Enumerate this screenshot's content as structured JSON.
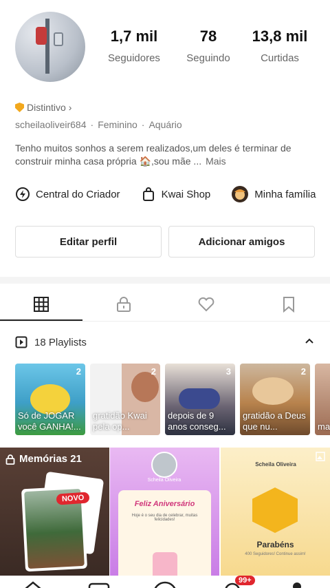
{
  "profile": {
    "avatar_icon": "iv-drip-avatar-photo",
    "stats": [
      {
        "value": "1,7 mil",
        "label": "Seguidores"
      },
      {
        "value": "78",
        "label": "Seguindo"
      },
      {
        "value": "13,8 mil",
        "label": "Curtidas"
      }
    ],
    "badge_label": "Distintivo",
    "badge_chevron": "›",
    "username": "scheilaoliveir684",
    "gender": "Feminino",
    "sign": "Aquário",
    "meta_separator": "·",
    "bio": "Tenho muitos sonhos a serem realizados,um deles é terminar de construir minha casa própria 🏠,sou mãe ...",
    "bio_more": "Mais"
  },
  "quick_links": [
    {
      "label": "Central do Criador",
      "icon": "bolt-circle-icon"
    },
    {
      "label": "Kwai Shop",
      "icon": "shopping-bag-icon"
    },
    {
      "label": "Minha família",
      "icon": "family-avatar-icon"
    }
  ],
  "buttons": {
    "edit_profile": "Editar perfil",
    "add_friends": "Adicionar amigos"
  },
  "tabs": [
    {
      "name": "grid",
      "icon": "grid-icon",
      "active": true
    },
    {
      "name": "private",
      "icon": "lock-icon",
      "active": false
    },
    {
      "name": "likes",
      "icon": "heart-icon",
      "active": false
    },
    {
      "name": "saved",
      "icon": "bookmark-icon",
      "active": false
    }
  ],
  "playlists": {
    "header": "18 Playlists",
    "items": [
      {
        "count": "2",
        "caption": "Só de JOGAR você GANHA!...",
        "color": "#4fb6d8"
      },
      {
        "count": "2",
        "caption": "gratidão Kwai pela op...",
        "color": "#e9d9d2"
      },
      {
        "count": "3",
        "caption": "depois de 9 anos conseg...",
        "color": "#3b3f56"
      },
      {
        "count": "2",
        "caption": "gratidão a Deus que nu...",
        "color": "#a86f45"
      },
      {
        "count": "",
        "caption": "ma de",
        "color": "#c9a28a"
      }
    ]
  },
  "grid": {
    "memories_label": "Memórias 21",
    "novo_badge": "NOVO",
    "birthday_card_title": "Feliz Aniversário",
    "birthday_card_text": "Hoje é o seu dia de celebrar, muitas felicidades!",
    "birthday_card_name": "Scheila Oliveira",
    "congrats_name": "Scheila Oliveira",
    "congrats_title": "Parabéns",
    "congrats_text": "400 Seguidores! Continue assim!"
  },
  "nav": {
    "notification_badge": "99+"
  },
  "colors": {
    "accent": "#e0262e",
    "badge": "#f2a81d"
  }
}
